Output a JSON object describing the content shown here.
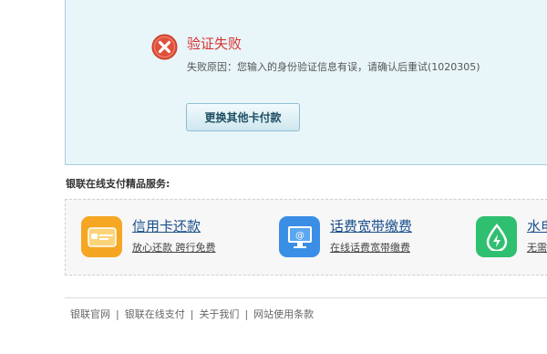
{
  "error": {
    "title": "验证失败",
    "reason": "失败原因：您输入的身份验证信息有误，请确认后重试(1020305)",
    "retry_button": "更换其他卡付款"
  },
  "services": {
    "heading": "银联在线支付精品服务:",
    "items": [
      {
        "title": "信用卡还款",
        "subtitle": "放心还款 跨行免费",
        "icon": "credit-card-icon",
        "color": "#f5a623"
      },
      {
        "title": "话费宽带缴费",
        "subtitle": "在线话费宽带缴费",
        "icon": "monitor-icon",
        "color": "#3a8ee6"
      },
      {
        "title": "水电",
        "subtitle": "无需",
        "icon": "water-drop-icon",
        "color": "#2fbf71"
      }
    ]
  },
  "footer": {
    "links": [
      "银联官网",
      "银联在线支付",
      "关于我们",
      "网站使用条款"
    ],
    "separator": "|"
  },
  "colors": {
    "error_red": "#d9332f",
    "panel_bg": "#e8f5f9",
    "link_blue": "#1a4f8b"
  }
}
